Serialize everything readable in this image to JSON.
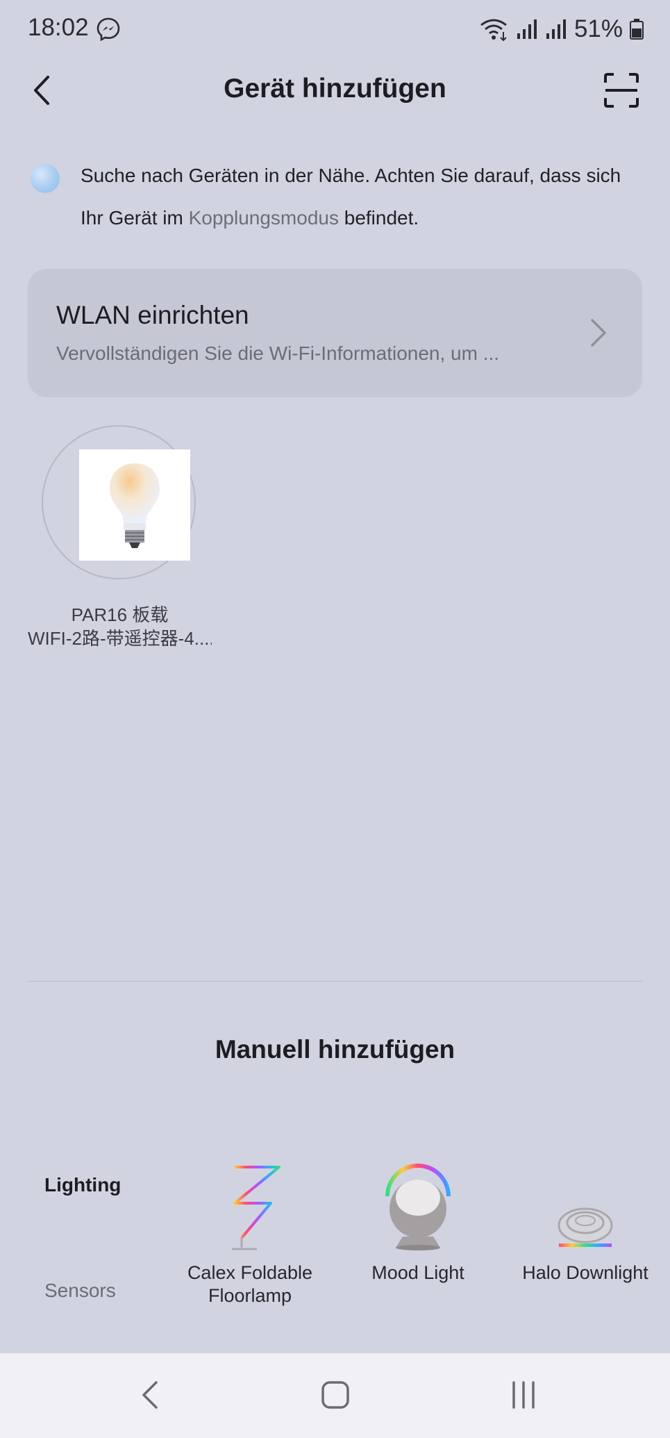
{
  "status_bar": {
    "time": "18:02",
    "battery_percent": "51%",
    "icons": [
      "messenger-icon",
      "wifi-icon",
      "signal-icon",
      "signal-icon",
      "battery-icon"
    ]
  },
  "header": {
    "title": "Gerät hinzufügen",
    "back_icon": "chevron-left-icon",
    "scan_icon": "scan-frame-icon"
  },
  "search": {
    "text_before_link": "Suche nach Geräten in der Nähe. Achten Sie darauf, dass sich Ihr Gerät im ",
    "link_text": "Kopplungsmodus",
    "text_after_link": " befindet."
  },
  "wlan": {
    "title": "WLAN einrichten",
    "subtitle": "Vervollständigen Sie die Wi-Fi-Informationen, um ..."
  },
  "found_devices": [
    {
      "name_line1": "PAR16 板载",
      "name_line2": "WIFI-2路-带遥控器-4...."
    }
  ],
  "manual": {
    "title": "Manuell hinzufügen",
    "categories": [
      {
        "label": "Lighting",
        "selected": true
      },
      {
        "label": "Sensors",
        "selected": false
      }
    ],
    "products": [
      {
        "label": "Calex Foldable Floorlamp",
        "icon": "floorlamp-icon"
      },
      {
        "label": "Mood Light",
        "icon": "mood-light-icon"
      },
      {
        "label": "Halo Downlight",
        "icon": "downlight-icon"
      }
    ]
  },
  "colors": {
    "background": "#d2d3e0",
    "card": "#c6c7d4",
    "nav_bar": "#f1f1f5",
    "link": "#6c6e79"
  }
}
